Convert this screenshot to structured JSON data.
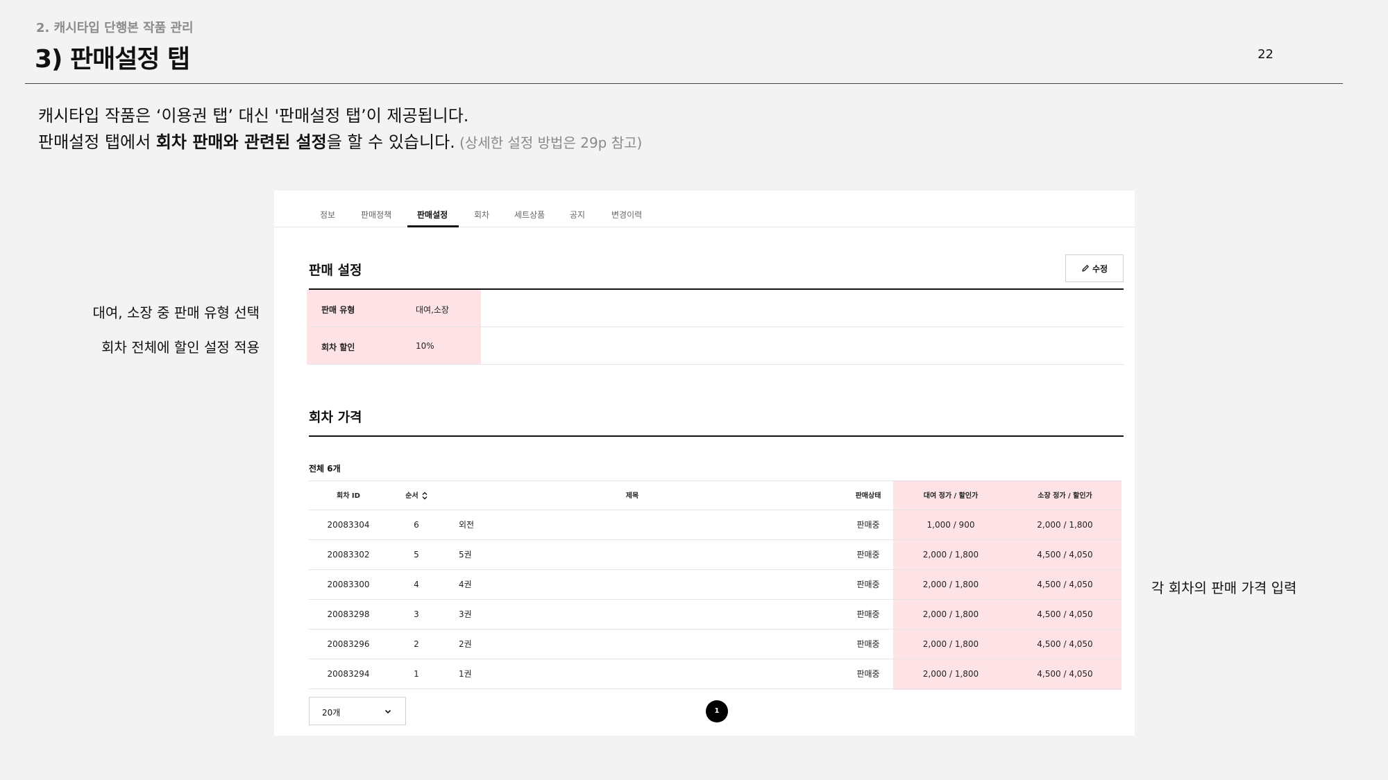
{
  "header": {
    "section_label": "2. 캐시타입 단행본 작품 관리",
    "title": "3) 판매설정 탭",
    "page_number": "22"
  },
  "intro": {
    "line1": "캐시타입 작품은 ‘이용권 탭’ 대신 '판매설정 탭’이 제공됩니다.",
    "line2_prefix": "판매설정 탭에서 ",
    "line2_bold": "회차 판매와 관련된 설정",
    "line2_suffix": "을 할 수 있습니다.",
    "line2_note": " (상세한 설정 방법은 29p 참고)"
  },
  "annotations": {
    "sale_type": "대여, 소장 중 판매 유형 선택",
    "discount": "회차 전체에 할인 설정 적용",
    "price": "각 회차의 판매 가격 입력"
  },
  "tabs": [
    {
      "label": "정보",
      "active": false
    },
    {
      "label": "판매정책",
      "active": false
    },
    {
      "label": "판매설정",
      "active": true
    },
    {
      "label": "회차",
      "active": false
    },
    {
      "label": "세트상품",
      "active": false
    },
    {
      "label": "공지",
      "active": false
    },
    {
      "label": "변경이력",
      "active": false
    }
  ],
  "sale_settings": {
    "title": "판매 설정",
    "edit_label": "수정",
    "rows": [
      {
        "key": "판매 유형",
        "value": "대여,소장"
      },
      {
        "key": "회차 할인",
        "value": "10%"
      }
    ]
  },
  "episode_prices": {
    "title": "회차 가격",
    "total": "전체 6개",
    "columns": {
      "id": "회차 ID",
      "order": "순서",
      "title": "제목",
      "status": "판매상태",
      "rent": "대여 정가 / 할인가",
      "own": "소장 정가 / 할인가"
    },
    "rows": [
      {
        "id": "20083304",
        "order": "6",
        "title": "외전",
        "status": "판매중",
        "rent": "1,000 / 900",
        "own": "2,000 / 1,800"
      },
      {
        "id": "20083302",
        "order": "5",
        "title": "5권",
        "status": "판매중",
        "rent": "2,000 / 1,800",
        "own": "4,500 / 4,050"
      },
      {
        "id": "20083300",
        "order": "4",
        "title": "4권",
        "status": "판매중",
        "rent": "2,000 / 1,800",
        "own": "4,500 / 4,050"
      },
      {
        "id": "20083298",
        "order": "3",
        "title": "3권",
        "status": "판매중",
        "rent": "2,000 / 1,800",
        "own": "4,500 / 4,050"
      },
      {
        "id": "20083296",
        "order": "2",
        "title": "2권",
        "status": "판매중",
        "rent": "2,000 / 1,800",
        "own": "4,500 / 4,050"
      },
      {
        "id": "20083294",
        "order": "1",
        "title": "1권",
        "status": "판매중",
        "rent": "2,000 / 1,800",
        "own": "4,500 / 4,050"
      }
    ],
    "page_size": "20개",
    "current_page": "1"
  },
  "colors": {
    "highlight": "#fde3e6",
    "background": "#f3f3f3",
    "panel": "#ffffff"
  }
}
